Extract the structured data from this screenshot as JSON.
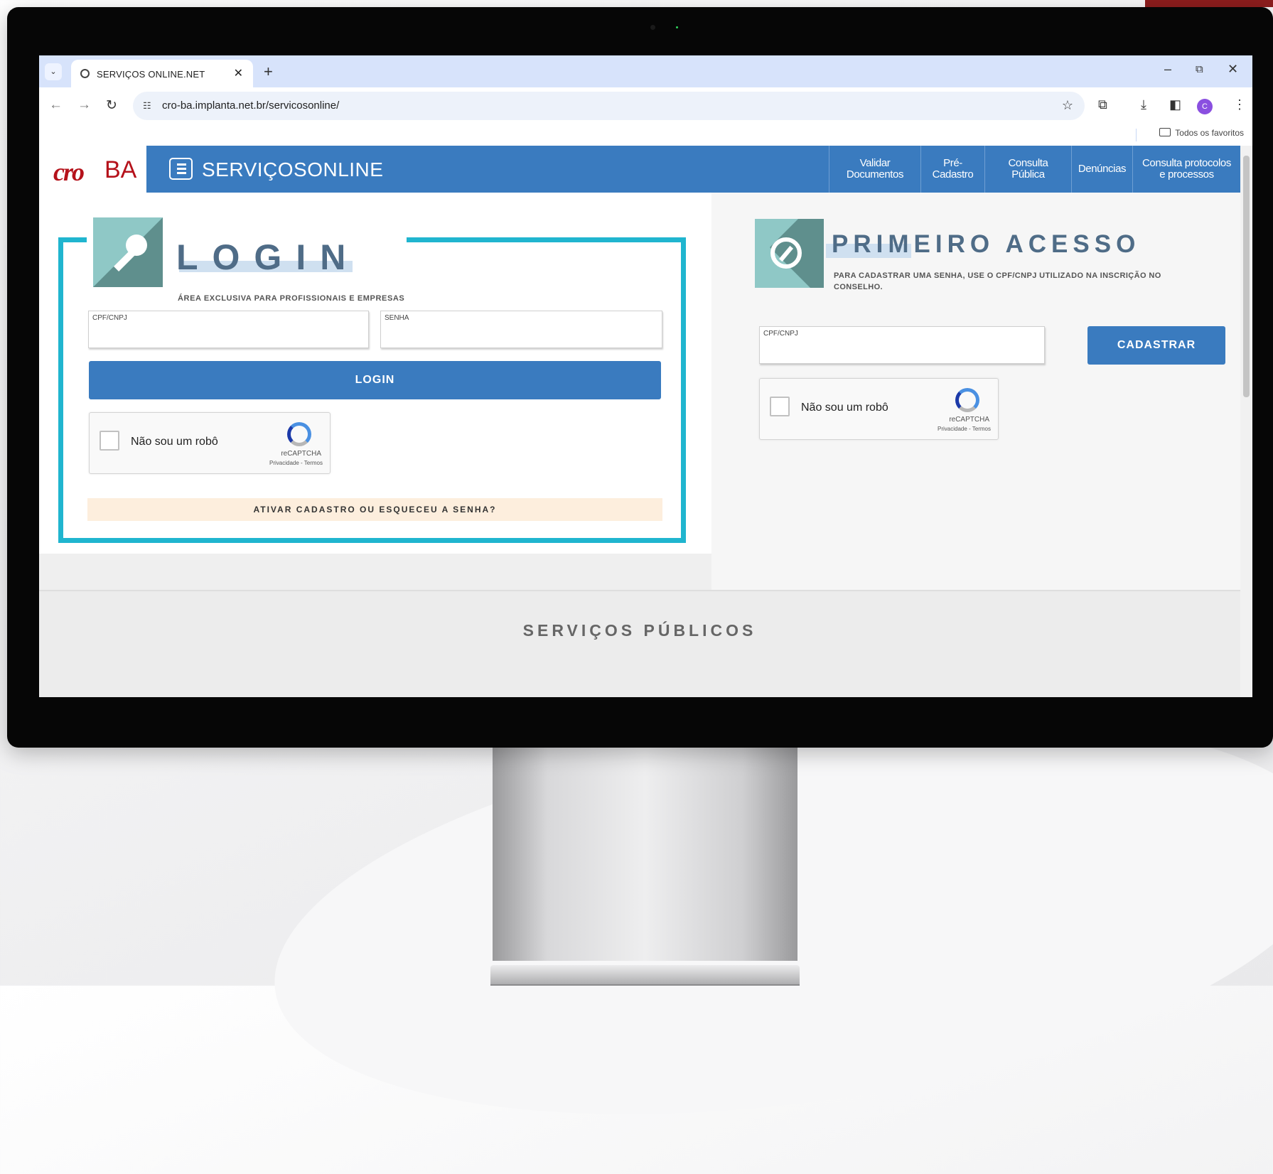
{
  "browser": {
    "tab_title": "SERVIÇOS ONLINE.NET",
    "tab_close": "✕",
    "new_tab": "+",
    "url": "cro-ba.implanta.net.br/servicosonline/",
    "bookmarks_folder": "Todos os favoritos",
    "avatar_initial": "C",
    "window_controls": [
      "–",
      "⧉",
      "✕"
    ]
  },
  "site": {
    "logo_mark": "cro",
    "logo_state": "BA",
    "brand_title": "SERVIÇOSONLINE",
    "nav": [
      "Validar Documentos",
      "Pré-Cadastro",
      "Consulta Pública",
      "Denúncias",
      "Consulta protocolos e processos"
    ]
  },
  "login": {
    "title": "LOGIN",
    "subtitle": "ÁREA EXCLUSIVA PARA PROFISSIONAIS E EMPRESAS",
    "cpf_label": "CPF/CNPJ",
    "password_label": "SENHA",
    "button": "LOGIN",
    "forgot": "ATIVAR CADASTRO OU ESQUECEU A SENHA?"
  },
  "captcha": {
    "text": "Não sou um robô",
    "brand": "reCAPTCHA",
    "terms": "Privacidade - Termos"
  },
  "first_access": {
    "title": "PRIMEIRO ACESSO",
    "subtitle": "PARA CADASTRAR UMA SENHA, USE O CPF/CNPJ UTILIZADO NA INSCRIÇÃO NO CONSELHO.",
    "cpf_label": "CPF/CNPJ",
    "button": "CADASTRAR"
  },
  "footer": {
    "title": "SERVIÇOS PÚBLICOS"
  },
  "colors": {
    "brand_blue": "#3a7bbf",
    "frame_cyan": "#20b5cf",
    "logo_red": "#b5121b"
  }
}
